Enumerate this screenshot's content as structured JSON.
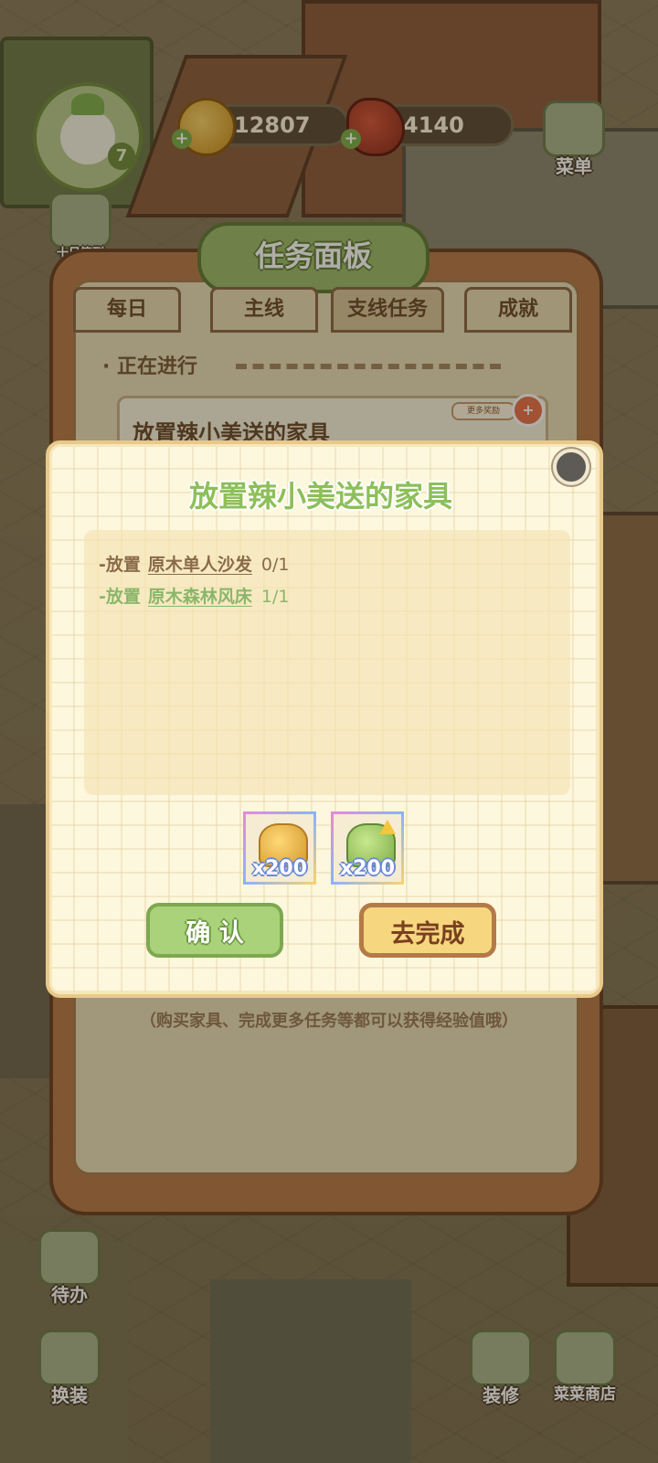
{
  "hud": {
    "level": "7",
    "coins": "12807",
    "meat": "4140",
    "menu_label": "菜单",
    "checkin_label": "十日签到"
  },
  "bottom_bar": {
    "todo_label": "待办",
    "dress_label": "换装",
    "decor_label": "装修",
    "shop_label": "菜菜商店"
  },
  "task_panel": {
    "title": "任务面板",
    "tabs": [
      "每日",
      "主线",
      "支线任务",
      "成就"
    ],
    "selected_tab": "支线任务",
    "section_label": "· 正在进行",
    "current_task": "放置辣小美送的家具",
    "more_rewards": "更多奖励",
    "hint": "（购买家具、完成更多任务等都可以获得经验值哦）"
  },
  "modal": {
    "title": "放置辣小美送的家具",
    "requirements": [
      {
        "prefix": "-放置",
        "item": "原木单人沙发",
        "progress": "0/1",
        "done": false
      },
      {
        "prefix": "-放置",
        "item": "原木森林风床",
        "progress": "1/1",
        "done": true
      }
    ],
    "rewards": [
      {
        "icon": "coin-pile-icon",
        "qty": "x200"
      },
      {
        "icon": "exp-leaf-icon",
        "qty": "x200"
      }
    ],
    "confirm_label": "确 认",
    "go_label": "去完成"
  }
}
